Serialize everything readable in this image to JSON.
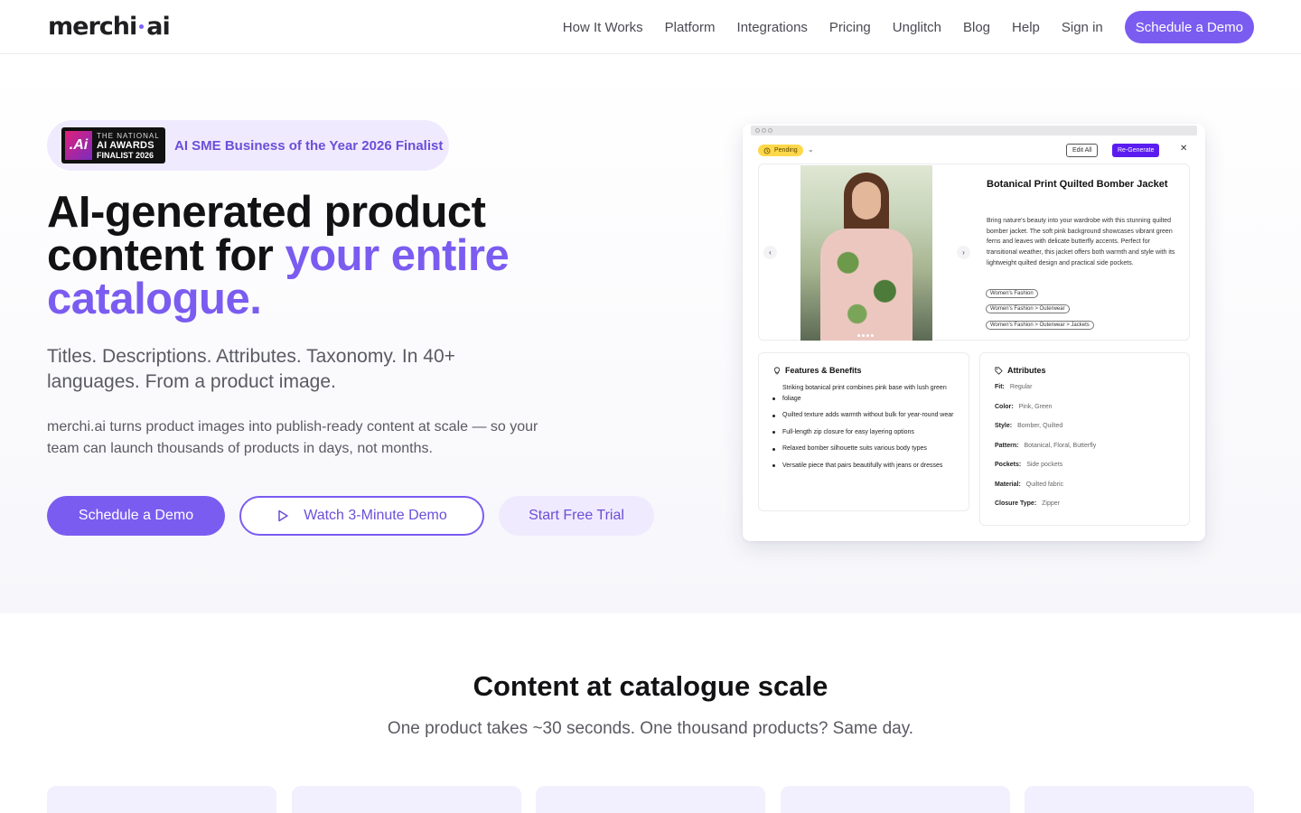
{
  "nav": {
    "logo_left": "merchi",
    "logo_right": "ai",
    "links": [
      "How It Works",
      "Platform",
      "Integrations",
      "Pricing",
      "Unglitch",
      "Blog",
      "Help",
      "Sign in"
    ],
    "cta": "Schedule a Demo"
  },
  "hero": {
    "award": {
      "badge_line1": "THE NATIONAL",
      "badge_line2": "AI AWARDS",
      "badge_line3": "FINALIST 2026",
      "text": "AI SME Business of the Year 2026 Finalist"
    },
    "headline_line1": "AI-generated product",
    "headline_line2_plain": "content for ",
    "headline_line2_accent": "your entire",
    "headline_line3_accent": "catalogue.",
    "subhead": "Titles. Descriptions. Attributes. Taxonomy. In 40+ languages. From a product image.",
    "body": "merchi.ai turns product images into publish-ready content at scale — so your team can launch thousands of products in days, not months.",
    "buttons": {
      "primary": "Schedule a Demo",
      "outline": "Watch 3-Minute Demo",
      "soft": "Start Free Trial"
    },
    "accent_color": "#7b5cf0"
  },
  "mockup": {
    "status": "Pending",
    "edit_all": "Edit All",
    "regenerate": "Re-Generate",
    "close": "✕",
    "product_title": "Botanical Print Quilted Bomber Jacket",
    "product_description": "Bring nature's beauty into your wardrobe with this stunning quilted bomber jacket. The soft pink background showcases vibrant green ferns and leaves with delicate butterfly accents. Perfect for transitional weather, this jacket offers both warmth and style with its lightweight quilted design and practical side pockets.",
    "tags": [
      "Women's Fashion",
      "Women's Fashion > Outerwear",
      "Women's Fashion > Outerwear > Jackets"
    ],
    "features_title": "Features & Benefits",
    "features": [
      "Striking botanical print combines pink base with lush green foliage",
      "Quilted texture adds warmth without bulk for year-round wear",
      "Full-length zip closure for easy layering options",
      "Relaxed bomber silhouette suits various body types",
      "Versatile piece that pairs beautifully with jeans or dresses"
    ],
    "attributes_title": "Attributes",
    "attributes": [
      {
        "key": "Fit:",
        "value": "Regular"
      },
      {
        "key": "Color:",
        "value": "Pink, Green"
      },
      {
        "key": "Style:",
        "value": "Bomber, Quilted"
      },
      {
        "key": "Pattern:",
        "value": "Botanical, Floral, Butterfly"
      },
      {
        "key": "Pockets:",
        "value": "Side pockets"
      },
      {
        "key": "Material:",
        "value": "Quilted fabric"
      },
      {
        "key": "Closure Type:",
        "value": "Zipper"
      }
    ]
  },
  "section2": {
    "title": "Content at catalogue scale",
    "subtitle": "One product takes ~30 seconds. One thousand products? Same day."
  }
}
